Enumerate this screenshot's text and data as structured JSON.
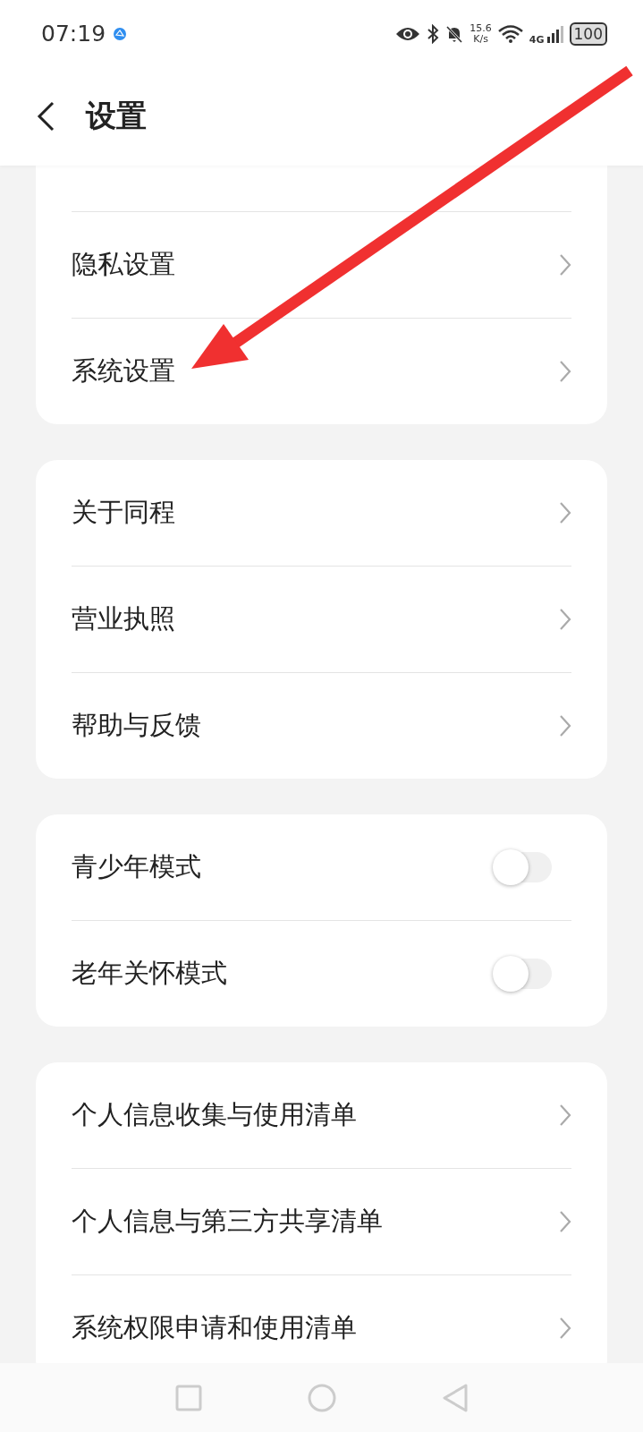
{
  "status_bar": {
    "time": "07:19",
    "speed": "15.6",
    "speed_unit": "K/s",
    "network": "4G",
    "battery": "100"
  },
  "header": {
    "title": "设置"
  },
  "groups": [
    {
      "items": [
        {
          "kind": "link",
          "label": "隐私设置"
        },
        {
          "kind": "link",
          "label": "系统设置"
        }
      ]
    },
    {
      "items": [
        {
          "kind": "link",
          "label": "关于同程"
        },
        {
          "kind": "link",
          "label": "营业执照"
        },
        {
          "kind": "link",
          "label": "帮助与反馈"
        }
      ]
    },
    {
      "items": [
        {
          "kind": "toggle",
          "label": "青少年模式",
          "on": false
        },
        {
          "kind": "toggle",
          "label": "老年关怀模式",
          "on": false
        }
      ]
    },
    {
      "items": [
        {
          "kind": "link",
          "label": "个人信息收集与使用清单"
        },
        {
          "kind": "link",
          "label": "个人信息与第三方共享清单"
        },
        {
          "kind": "link",
          "label": "系统权限申请和使用清单"
        }
      ]
    }
  ],
  "annotation": {
    "kind": "arrow"
  }
}
